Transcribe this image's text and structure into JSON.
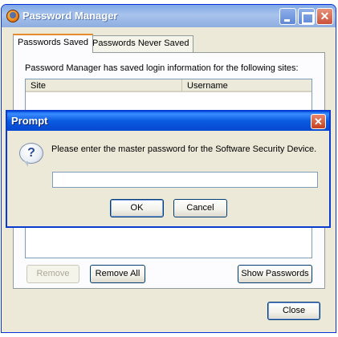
{
  "password_manager": {
    "title": "Password Manager",
    "tabs": [
      {
        "label": "Passwords Saved",
        "active": true
      },
      {
        "label": "Passwords Never Saved",
        "active": false
      }
    ],
    "description": "Password Manager has saved login information for the following sites:",
    "columns": [
      "Site",
      "Username"
    ],
    "buttons": {
      "remove": "Remove",
      "remove_all": "Remove All",
      "show_passwords": "Show Passwords",
      "close": "Close"
    }
  },
  "prompt": {
    "title": "Prompt",
    "message": "Please enter the master password for the Software Security Device.",
    "input_value": "",
    "ok": "OK",
    "cancel": "Cancel",
    "close_glyph": "✕",
    "icon": "question-icon"
  },
  "colors": {
    "xp_face": "#ece9d8",
    "prompt_title": "#0a5ae0",
    "pm_title_inactive": "#8eaee0"
  }
}
